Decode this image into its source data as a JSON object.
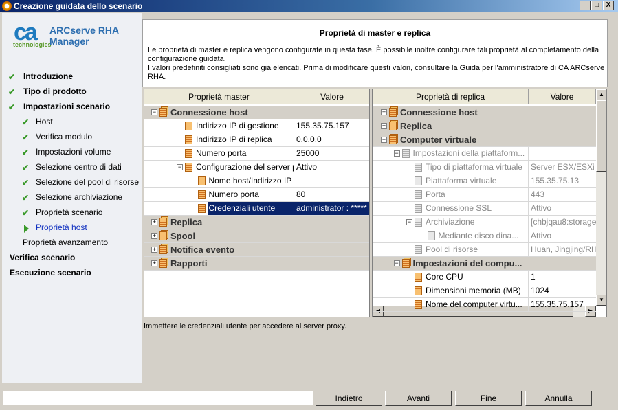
{
  "window": {
    "title": "Creazione guidata dello scenario",
    "controls": [
      "_",
      "□",
      "X"
    ]
  },
  "logo": {
    "brand": "ca",
    "tagline": "technologies",
    "product": "ARCserve RHA Manager"
  },
  "steps": [
    {
      "label": "Introduzione",
      "level": 0,
      "state": "done"
    },
    {
      "label": "Tipo di prodotto",
      "level": 0,
      "state": "done"
    },
    {
      "label": "Impostazioni scenario",
      "level": 0,
      "state": "done"
    },
    {
      "label": "Host",
      "level": 1,
      "state": "done"
    },
    {
      "label": "Verifica modulo",
      "level": 1,
      "state": "done"
    },
    {
      "label": "Impostazioni volume",
      "level": 1,
      "state": "done"
    },
    {
      "label": "Selezione centro di dati",
      "level": 1,
      "state": "done"
    },
    {
      "label": "Selezione del pool di risorse",
      "level": 1,
      "state": "done"
    },
    {
      "label": "Selezione archiviazione",
      "level": 1,
      "state": "done"
    },
    {
      "label": "Proprietà scenario",
      "level": 1,
      "state": "done"
    },
    {
      "label": "Proprietà host",
      "level": 1,
      "state": "current"
    },
    {
      "label": "Proprietà avanzamento",
      "level": 1,
      "state": "pending"
    },
    {
      "label": "Verifica scenario",
      "level": 0,
      "state": "pending"
    },
    {
      "label": "Esecuzione scenario",
      "level": 0,
      "state": "pending"
    }
  ],
  "header": {
    "title": "Proprietà di master e replica",
    "description": "Le proprietà di master e replica vengono configurate in questa fase. È possibile inoltre configurare tali proprietà al completamento della configurazione guidata.\nI valori predefiniti consigliati sono già elencati. Prima di modificare questi valori, consultare la Guida per l'amministratore di CA ARCserve RHA."
  },
  "master": {
    "col_name": "Proprietà master",
    "col_value": "Valore",
    "rows": [
      {
        "name": "Connessione host",
        "value": "",
        "type": "group",
        "level": 0,
        "expander": "-"
      },
      {
        "name": "Indirizzo IP di gestione",
        "value": "155.35.75.157",
        "type": "item",
        "level": 2
      },
      {
        "name": "Indirizzo IP di replica",
        "value": "0.0.0.0",
        "type": "item",
        "level": 2
      },
      {
        "name": "Numero porta",
        "value": "25000",
        "type": "item",
        "level": 2
      },
      {
        "name": "Configurazione del server p...",
        "value": "Attivo",
        "type": "item",
        "level": 2,
        "expander": "-"
      },
      {
        "name": "Nome host/Indirizzo IP",
        "value": "",
        "type": "item",
        "level": 3
      },
      {
        "name": "Numero porta",
        "value": "80",
        "type": "item",
        "level": 3
      },
      {
        "name": "Credenziali utente",
        "value": "administrator : *****",
        "type": "item",
        "level": 3,
        "selected": true
      },
      {
        "name": "Replica",
        "value": "",
        "type": "group",
        "level": 0,
        "expander": "+"
      },
      {
        "name": "Spool",
        "value": "",
        "type": "group",
        "level": 0,
        "expander": "+"
      },
      {
        "name": "Notifica evento",
        "value": "",
        "type": "group",
        "level": 0,
        "expander": "+"
      },
      {
        "name": "Rapporti",
        "value": "",
        "type": "group",
        "level": 0,
        "expander": "+"
      }
    ]
  },
  "replica": {
    "col_name": "Proprietà di replica",
    "col_value": "Valore",
    "rows": [
      {
        "name": "Connessione host",
        "value": "",
        "type": "group",
        "level": 0,
        "expander": "+"
      },
      {
        "name": "Replica",
        "value": "",
        "type": "group",
        "level": 0,
        "expander": "+"
      },
      {
        "name": "Computer virtuale",
        "value": "",
        "type": "group",
        "level": 0,
        "expander": "-"
      },
      {
        "name": "Impostazioni della piattaform...",
        "value": "",
        "type": "item",
        "level": 1,
        "expander": "-",
        "disabled": true
      },
      {
        "name": "Tipo di piattaforma virtuale",
        "value": "Server ESX/ESXi",
        "type": "item",
        "level": 2,
        "disabled": true
      },
      {
        "name": "Piattaforma virtuale",
        "value": "155.35.75.13",
        "type": "item",
        "level": 2,
        "disabled": true
      },
      {
        "name": "Porta",
        "value": "443",
        "type": "item",
        "level": 2,
        "disabled": true
      },
      {
        "name": "Connessione SSL",
        "value": "Attivo",
        "type": "item",
        "level": 2,
        "disabled": true
      },
      {
        "name": "Archiviazione",
        "value": "[chbjqau8:storage",
        "type": "item",
        "level": 2,
        "expander": "-",
        "disabled": true
      },
      {
        "name": "Mediante disco dina...",
        "value": "Attivo",
        "type": "item",
        "level": 3,
        "disabled": true
      },
      {
        "name": "Pool di risorse",
        "value": "Huan, Jingjing/RH",
        "type": "item",
        "level": 2,
        "disabled": true
      },
      {
        "name": "Impostazioni del compu...",
        "value": "",
        "type": "group",
        "level": 1,
        "expander": "-"
      },
      {
        "name": "Core CPU",
        "value": "1",
        "type": "item",
        "level": 2
      },
      {
        "name": "Dimensioni memoria (MB)",
        "value": "1024",
        "type": "item",
        "level": 2
      },
      {
        "name": "Nome del computer virtu...",
        "value": "155.35.75.157",
        "type": "item",
        "level": 2
      }
    ]
  },
  "status": "Immettere le credenziali utente per accedere al server proxy.",
  "buttons": {
    "back": "Indietro",
    "next": "Avanti",
    "finish": "Fine",
    "cancel": "Annulla"
  }
}
